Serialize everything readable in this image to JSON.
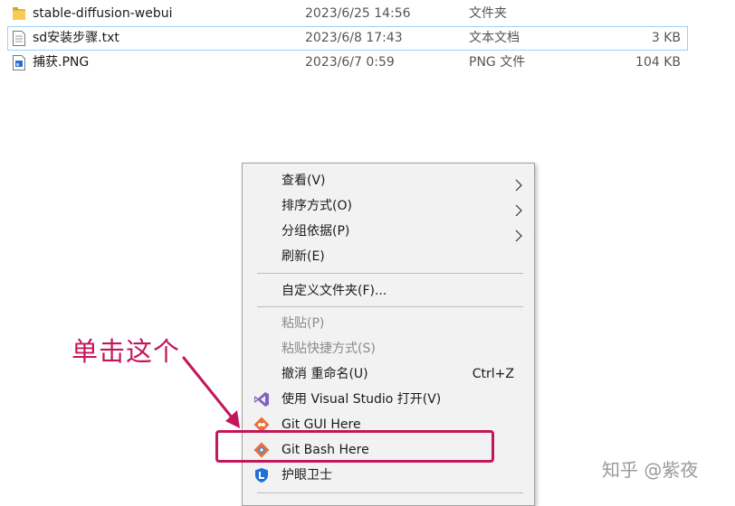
{
  "files": [
    {
      "name": "stable-diffusion-webui",
      "date": "2023/6/25 14:56",
      "type": "文件夹",
      "size": "",
      "icon": "folder-icon"
    },
    {
      "name": "sd安装步骤.txt",
      "date": "2023/6/8 17:43",
      "type": "文本文档",
      "size": "3 KB",
      "icon": "text-file-icon"
    },
    {
      "name": "捕获.PNG",
      "date": "2023/6/7 0:59",
      "type": "PNG 文件",
      "size": "104 KB",
      "icon": "image-file-icon"
    }
  ],
  "menu": {
    "view": "查看(V)",
    "sort": "排序方式(O)",
    "group": "分组依据(P)",
    "refresh": "刷新(E)",
    "customize": "自定义文件夹(F)...",
    "paste": "粘贴(P)",
    "paste_shortcut": "粘贴快捷方式(S)",
    "undo": "撤消 重命名(U)",
    "undo_shortcut": "Ctrl+Z",
    "visual_studio": "使用 Visual Studio 打开(V)",
    "git_gui": "Git GUI Here",
    "git_bash": "Git Bash Here",
    "eye_guard": "护眼卫士"
  },
  "annotation": {
    "text": "单击这个"
  },
  "watermark": {
    "text": "知乎 @紫夜"
  },
  "colors": {
    "accent": "#c2185b",
    "selection_border": "#99d1ff",
    "menu_bg": "#f2f2f2"
  }
}
